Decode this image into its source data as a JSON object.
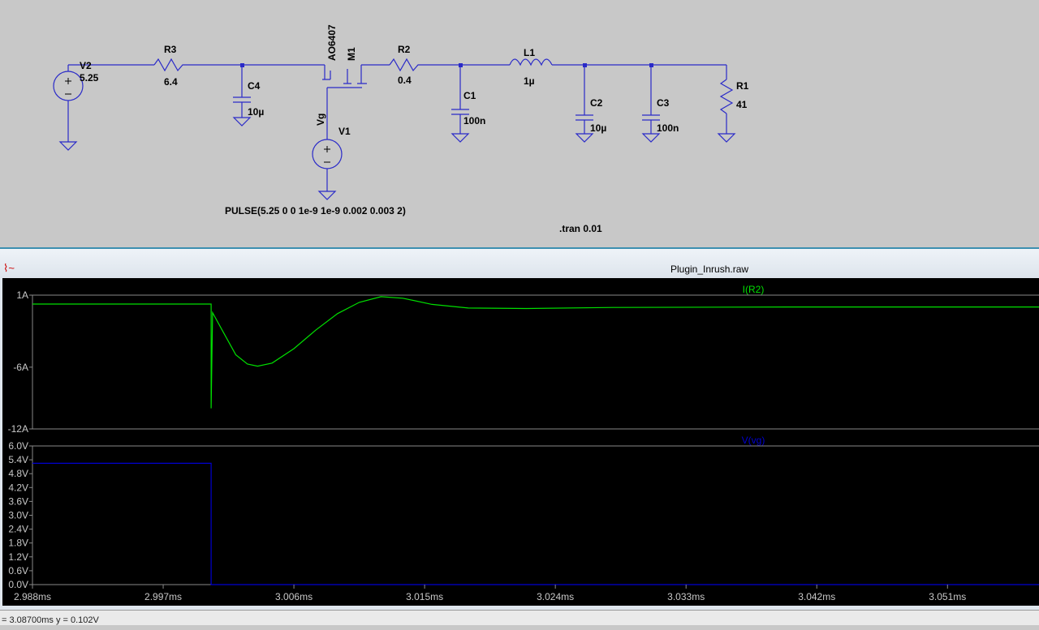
{
  "schematic": {
    "components": {
      "V2": {
        "name": "V2",
        "value": "5.25"
      },
      "R3": {
        "name": "R3",
        "value": "6.4"
      },
      "C4": {
        "name": "C4",
        "value": "10µ"
      },
      "M1": {
        "name": "M1",
        "value": "AO6407"
      },
      "R2": {
        "name": "R2",
        "value": "0.4"
      },
      "C1": {
        "name": "C1",
        "value": "100n"
      },
      "L1": {
        "name": "L1",
        "value": "1µ"
      },
      "C2": {
        "name": "C2",
        "value": "10µ"
      },
      "C3": {
        "name": "C3",
        "value": "100n"
      },
      "R1": {
        "name": "R1",
        "value": "41"
      },
      "V1": {
        "name": "V1",
        "value": ""
      }
    },
    "net_label": "Vg",
    "pulse_directive": "PULSE(5.25 0 0 1e-9 1e-9 0.002 0.003 2)",
    "tran_directive": ".tran 0.01"
  },
  "waveform": {
    "title": "Plugin_Inrush.raw",
    "icon": "waveform-icon",
    "status": "= 3.08700ms   y = 0.102V"
  },
  "chart_data": [
    {
      "type": "line",
      "title": "I(R2)",
      "color": "#00e000",
      "ylabel": "A",
      "ylim": [
        -12,
        1
      ],
      "yticks": [
        "1A",
        "-6A",
        "-12A"
      ],
      "ytick_values": [
        1,
        -6,
        -12
      ],
      "x": [
        2.988,
        3.0003,
        3.0003,
        3.0004,
        3.0011,
        3.002,
        3.0028,
        3.0035,
        3.0045,
        3.006,
        3.0075,
        3.009,
        3.0105,
        3.012,
        3.0135,
        3.0155,
        3.018,
        3.022,
        3.028,
        3.04,
        3.0573
      ],
      "y": [
        0.13,
        0.13,
        -10,
        -0.7,
        -2.5,
        -4.8,
        -5.7,
        -5.9,
        -5.6,
        -4.2,
        -2.4,
        -0.8,
        0.3,
        0.85,
        0.7,
        0.1,
        -0.25,
        -0.3,
        -0.2,
        -0.15,
        -0.15
      ]
    },
    {
      "type": "line",
      "title": "V(vg)",
      "color": "#0000d0",
      "ylabel": "V",
      "ylim": [
        0,
        6
      ],
      "yticks": [
        "6.0V",
        "5.4V",
        "4.8V",
        "4.2V",
        "3.6V",
        "3.0V",
        "2.4V",
        "1.8V",
        "1.2V",
        "0.6V",
        "0.0V"
      ],
      "ytick_values": [
        6,
        5.4,
        4.8,
        4.2,
        3.6,
        3.0,
        2.4,
        1.8,
        1.2,
        0.6,
        0
      ],
      "x": [
        2.988,
        3.0003,
        3.0003,
        3.0573
      ],
      "y": [
        5.25,
        5.25,
        0,
        0
      ]
    }
  ],
  "xaxis": {
    "xlim": [
      2.988,
      3.0573
    ],
    "ticks": [
      "2.988ms",
      "2.997ms",
      "3.006ms",
      "3.015ms",
      "3.024ms",
      "3.033ms",
      "3.042ms",
      "3.051ms"
    ],
    "tick_values": [
      2.988,
      2.997,
      3.006,
      3.015,
      3.024,
      3.033,
      3.042,
      3.051
    ]
  }
}
